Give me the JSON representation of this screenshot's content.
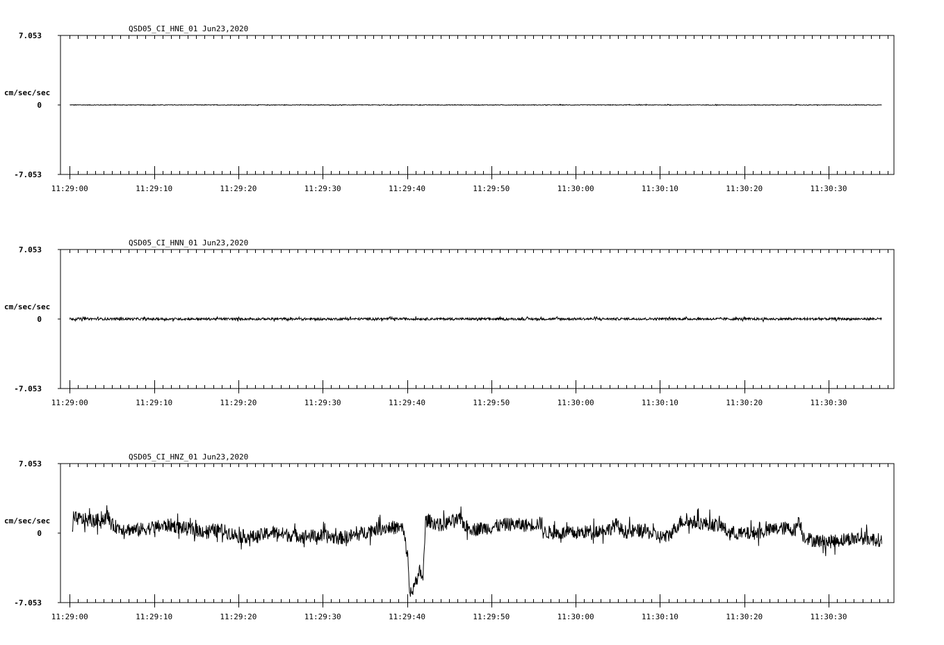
{
  "chart_data": [
    {
      "type": "line",
      "title": "QSD05_CI_HNE_01  Jun23,2020",
      "ylabel": "cm/sec/sec",
      "ylim": [
        -7.053,
        7.053
      ],
      "ytick_labels": [
        "7.053",
        "0",
        "-7.053"
      ],
      "xtick_labels": [
        "11:29:00",
        "11:29:10",
        "11:29:20",
        "11:29:30",
        "11:29:40",
        "11:29:50",
        "11:30:00",
        "11:30:10",
        "11:30:20",
        "11:30:30"
      ],
      "series": [
        {
          "x": [
            0,
            10,
            20,
            30,
            40,
            50,
            60,
            70,
            80,
            90,
            96.3
          ],
          "y": [
            0,
            0,
            0,
            0,
            0,
            0,
            0,
            0,
            0,
            0,
            0
          ],
          "noise": 0.03
        }
      ]
    },
    {
      "type": "line",
      "title": "QSD05_CI_HNN_01  Jun23,2020",
      "ylabel": "cm/sec/sec",
      "ylim": [
        -7.053,
        7.053
      ],
      "ytick_labels": [
        "7.053",
        "0",
        "-7.053"
      ],
      "xtick_labels": [
        "11:29:00",
        "11:29:10",
        "11:29:20",
        "11:29:30",
        "11:29:40",
        "11:29:50",
        "11:30:00",
        "11:30:10",
        "11:30:20",
        "11:30:30"
      ],
      "series": [
        {
          "x": [
            0,
            10,
            20,
            30,
            40,
            50,
            60,
            70,
            80,
            90,
            96.3
          ],
          "y": [
            0.02,
            0,
            0.01,
            0,
            0.02,
            0,
            0.01,
            0.02,
            0,
            0.01,
            0.01
          ],
          "noise": 0.12
        }
      ]
    },
    {
      "type": "line",
      "title": "QSD05_CI_HNZ_01  Jun23,2020",
      "ylabel": "cm/sec/sec",
      "ylim": [
        -7.053,
        7.053
      ],
      "ytick_labels": [
        "7.053",
        "0",
        "-7.053"
      ],
      "xtick_labels": [
        "11:29:00",
        "11:29:10",
        "11:29:20",
        "11:29:30",
        "11:29:40",
        "11:29:50",
        "11:30:00",
        "11:30:10",
        "11:30:20",
        "11:30:30"
      ],
      "series": [
        {
          "x": [
            0.3,
            0.6,
            3,
            4,
            4.6,
            5,
            6,
            8,
            10,
            12,
            14,
            16,
            18,
            20,
            22,
            24,
            26,
            28,
            30,
            32,
            34,
            36,
            38,
            39.5,
            40.1,
            40.3,
            40.6,
            40.9,
            41.2,
            41.5,
            41.9,
            42.2,
            42.5,
            43,
            44,
            45,
            46.4,
            47,
            48,
            50,
            52,
            54,
            56,
            56.1,
            58,
            60,
            62,
            64,
            64.8,
            65.3,
            66,
            68,
            70,
            71,
            72.5,
            74,
            76,
            77.4,
            78,
            80,
            82,
            83.5,
            85,
            86,
            86.5,
            87,
            88,
            90,
            92,
            94,
            96,
            96.3
          ],
          "y": [
            0.3,
            1.5,
            1.2,
            1.5,
            1.6,
            0.8,
            0.5,
            0.3,
            0.6,
            0.8,
            0.4,
            0.2,
            0.3,
            -0.3,
            -0.4,
            0.1,
            -0.2,
            -0.3,
            -0.3,
            -0.5,
            -0.2,
            0.4,
            0.6,
            0.5,
            -2.5,
            -5.8,
            -6.4,
            -4.5,
            -5.2,
            -3.8,
            -4.6,
            1.2,
            1.3,
            1.1,
            0.8,
            1.1,
            1.4,
            0.6,
            0.4,
            0.6,
            0.9,
            0.8,
            1.0,
            0.1,
            0.0,
            0.0,
            0.2,
            0.4,
            0.9,
            0.4,
            0.1,
            0.3,
            -0.4,
            -0.3,
            1.2,
            1.1,
            0.9,
            0.7,
            0.1,
            -0.1,
            0.1,
            0.4,
            0.5,
            0.3,
            1.4,
            -0.3,
            -0.7,
            -0.9,
            -0.6,
            -0.5,
            -0.7,
            -0.8
          ],
          "noise": 0.7
        }
      ]
    }
  ]
}
